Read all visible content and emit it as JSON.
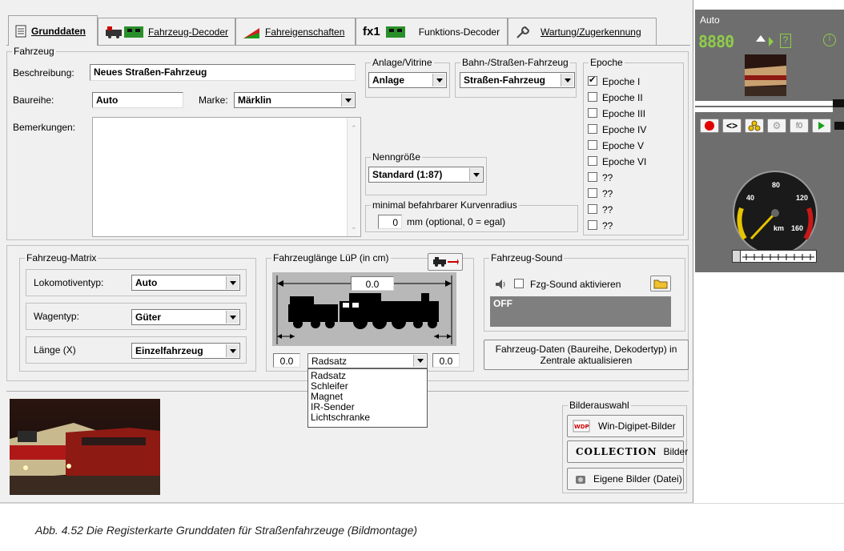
{
  "tabs": [
    {
      "label": "Grunddaten",
      "icon": "document-icon"
    },
    {
      "label": "Fahrzeug-Decoder",
      "icon": "locomotive-decoder-icon"
    },
    {
      "label": "Fahreigenschaften",
      "icon": "speed-curve-icon"
    },
    {
      "label": "Funktions-Decoder",
      "prefix": "fx1",
      "icon": "function-decoder-icon"
    },
    {
      "label": "Wartung/Zugerkennung",
      "icon": "wrench-icon"
    }
  ],
  "fahrzeug": {
    "group_title": "Fahrzeug",
    "beschreibung_label": "Beschreibung:",
    "beschreibung_value": "Neues Straßen-Fahrzeug",
    "baureihe_label": "Baureihe:",
    "baureihe_value": "Auto",
    "marke_label": "Marke:",
    "marke_value": "Märklin",
    "bemerkungen_label": "Bemerkungen:"
  },
  "anlage": {
    "title": "Anlage/Vitrine",
    "value": "Anlage"
  },
  "bahn": {
    "title": "Bahn-/Straßen-Fahrzeug",
    "value": "Straßen-Fahrzeug"
  },
  "nenngroesse": {
    "title": "Nenngröße",
    "value": "Standard (1:87)"
  },
  "radius": {
    "title": "minimal befahrbarer Kurvenradius",
    "value": "0",
    "unit": "mm (optional, 0 = egal)"
  },
  "epoche": {
    "title": "Epoche",
    "items": [
      {
        "label": "Epoche I",
        "checked": true
      },
      {
        "label": "Epoche II",
        "checked": false
      },
      {
        "label": "Epoche III",
        "checked": false
      },
      {
        "label": "Epoche IV",
        "checked": false
      },
      {
        "label": "Epoche V",
        "checked": false
      },
      {
        "label": "Epoche VI",
        "checked": false
      },
      {
        "label": "??",
        "checked": false
      },
      {
        "label": "??",
        "checked": false
      },
      {
        "label": "??",
        "checked": false
      },
      {
        "label": "??",
        "checked": false
      }
    ]
  },
  "matrix": {
    "title": "Fahrzeug-Matrix",
    "lokomotivtyp_label": "Lokomotiventyp:",
    "lokomotivtyp_value": "Auto",
    "wagentyp_label": "Wagentyp:",
    "wagentyp_value": "Güter",
    "laenge_label": "Länge (X)",
    "laenge_value": "Einzelfahrzeug"
  },
  "laenge": {
    "title": "Fahrzeuglänge LüP (in cm)",
    "total": "0.0",
    "left": "0.0",
    "right": "0.0",
    "sensor_value": "Radsatz",
    "options": [
      "Radsatz",
      "Schleifer",
      "Magnet",
      "IR-Sender",
      "Lichtschranke"
    ]
  },
  "sound": {
    "title": "Fahrzeug-Sound",
    "checkbox_label": "Fzg-Sound aktivieren",
    "status": "OFF"
  },
  "update_button": "Fahrzeug-Daten (Baureihe, Dekodertyp) in Zentrale aktualisieren",
  "bilder": {
    "title": "Bilderauswahl",
    "win_digipet": "Win-Digipet-Bilder",
    "collection_logo": "COLLECTION",
    "collection_label": "Bilder",
    "eigene": "Eigene Bilder (Datei)"
  },
  "right_panel": {
    "title": "Auto",
    "digits": "8880",
    "function_label": "f0",
    "speed_ticks": [
      "40",
      "80",
      "120",
      "160"
    ],
    "speed_unit": "km",
    "slider_value": "0"
  },
  "caption": "Abb. 4.52 Die Registerkarte Grunddaten für Straßenfahrzeuge (Bildmontage)",
  "colors": {
    "dialog_bg": "#f0f0f0",
    "dark_panel": "#6e6e6e",
    "sound_display": "#7f7f7f",
    "led_red": "#e00000"
  }
}
